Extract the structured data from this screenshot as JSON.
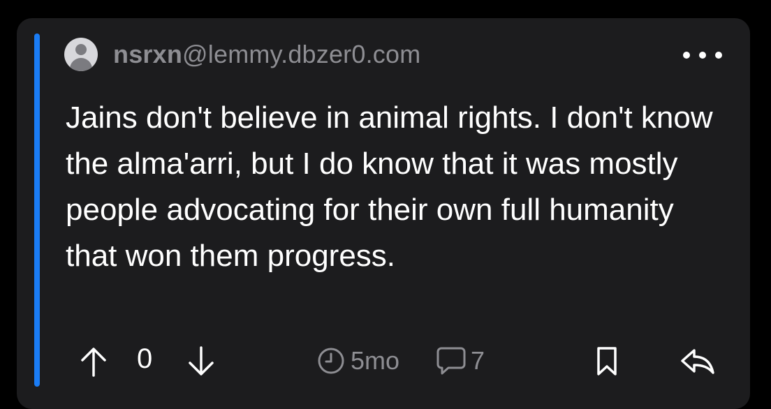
{
  "comment": {
    "author_user": "nsrxn",
    "author_instance": "@lemmy.dbzer0.com",
    "body": "Jains don't believe in animal rights. I don't know the alma'arri, but I do know that it was mostly people advocating for their own full humanity that won them progress.",
    "score": "0",
    "age": "5mo",
    "reply_count": "7"
  },
  "colors": {
    "background": "#000000",
    "card": "#1c1c1e",
    "thread_bar": "#1a7cf5",
    "muted_text": "#8e8e93",
    "primary_text": "#ffffff"
  },
  "icons": {
    "avatar": "person-placeholder-icon",
    "more": "ellipsis-icon",
    "upvote": "arrow-up-icon",
    "downvote": "arrow-down-icon",
    "age": "clock-icon",
    "replies": "speech-bubble-icon",
    "save": "bookmark-icon",
    "reply": "reply-arrow-icon"
  }
}
